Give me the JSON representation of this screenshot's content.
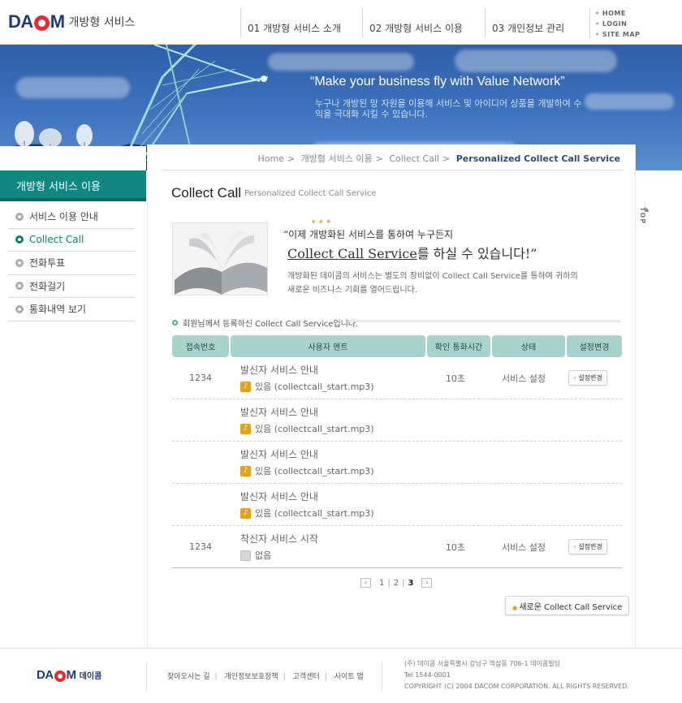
{
  "header": {
    "logo_text_1": "DA",
    "logo_text_2": "M",
    "logo_sub": "개방형 서비스",
    "nav": [
      "01 개방형 서비스 소개",
      "02 개방형 서비스 이용",
      "03 개인정보 관리"
    ],
    "util": [
      "HOME",
      "LOGIN",
      "SITE MAP"
    ]
  },
  "banner": {
    "headline": "“Make your business fly with Value Network”",
    "desc": "누구나 개방된 망 자원을 이용해 서비스 및 아이디어 상품을 개발하여 수익을 극대화 시킬 수 있습니다."
  },
  "sidebar": {
    "title": "개방형 서비스 이용",
    "items": [
      {
        "label": "서비스 이용 안내",
        "active": false
      },
      {
        "label": "Collect Call",
        "active": true
      },
      {
        "label": "전화투표",
        "active": false
      },
      {
        "label": "전화걸기",
        "active": false
      },
      {
        "label": "통화내역 보기",
        "active": false
      }
    ]
  },
  "breadcrumb": [
    "Home",
    "개방형 서비스 이용",
    "Collect Call",
    "Personalized Collect Call Service"
  ],
  "page": {
    "title": "Collect Call",
    "subtitle": "Personalized Collect Call Service",
    "stars": "★★★",
    "quote_line1": "“이제 개방화된 서비스를 통하여 누구든지",
    "quote_line2_u": "Collect Call Service",
    "quote_line2_rest": "를 하실 수 있습니다!”",
    "intro": "개방화된 데이콤의 서비스는 별도의 장비없이 Collect Call Service를 통하여 귀하의 새로운 비즈니스 기회를 열어드립니다.",
    "notice": "회원님께서 등록하신 Collect Call Service입니다."
  },
  "table": {
    "headers": [
      "접속번호",
      "사용자 멘트",
      "확인 통화시간",
      "상태",
      "설정변경"
    ],
    "rows": [
      {
        "number": "1234",
        "ment": "발신자 서비스 안내",
        "file_label": "있음 (collectcall_start.mp3)",
        "has_file": true,
        "time": "10초",
        "status": "서비스 설정",
        "button": "설정변경"
      },
      {
        "number": "",
        "ment": "발신자 서비스 안내",
        "file_label": "있음 (collectcall_start.mp3)",
        "has_file": true,
        "time": "",
        "status": "",
        "button": ""
      },
      {
        "number": "",
        "ment": "발신자 서비스 안내",
        "file_label": "있음 (collectcall_start.mp3)",
        "has_file": true,
        "time": "",
        "status": "",
        "button": ""
      },
      {
        "number": "",
        "ment": "발신자 서비스 안내",
        "file_label": "있음 (collectcall_start.mp3)",
        "has_file": true,
        "time": "",
        "status": "",
        "button": ""
      },
      {
        "number": "1234",
        "ment": "착신자 서비스 시작",
        "file_label": "없음",
        "has_file": false,
        "time": "10초",
        "status": "서비스 설정",
        "button": "설정변경"
      }
    ]
  },
  "pager": {
    "prev": "‹",
    "next": "›",
    "pages": [
      "1",
      "2",
      "3"
    ],
    "current": "3"
  },
  "new_button": "새로운 Collect Call Service",
  "right_rail": {
    "top": "TOP"
  },
  "footer": {
    "logo_sub": "데이콤",
    "links": [
      "찾아오시는 길",
      "개인정보보호정책",
      "고객센터",
      "사이트 맵"
    ],
    "address": "(주) 데이콤 서울특별시 강남구 역삼동 706-1 데이콤빌딩",
    "tel": "Tel 1544-0001",
    "copyright": "COPYRIGHT (C) 2004 DACOM CORPORATION. ALL RIGHTS RESERVED."
  },
  "colors": {
    "brand_navy": "#1f3a78",
    "brand_red": "#e32c2c",
    "section_teal": "#11887f",
    "table_header": "#a8d3cd",
    "accent_gold": "#e2a21f"
  }
}
